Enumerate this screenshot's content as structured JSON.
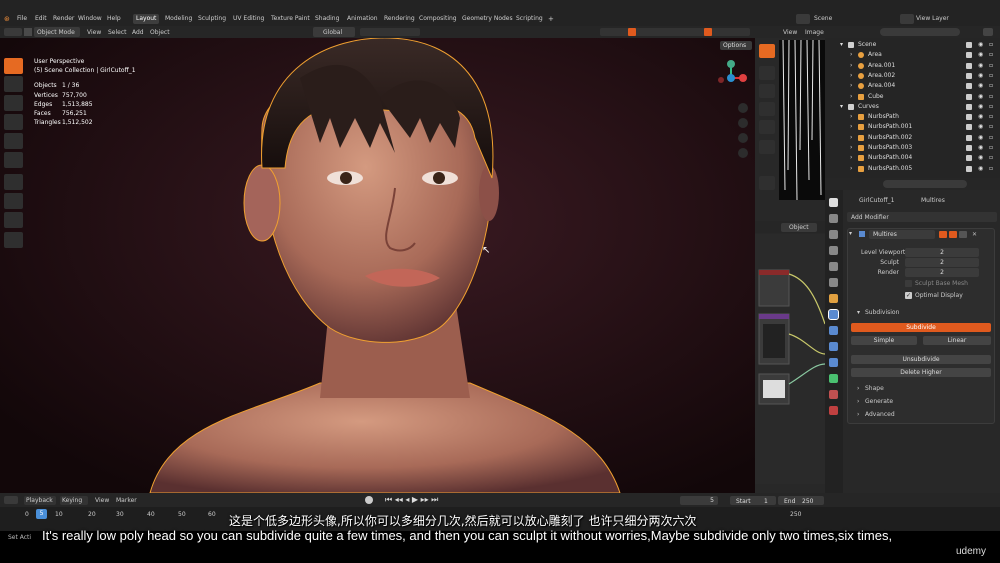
{
  "menu": [
    "File",
    "Edit",
    "Render",
    "Window",
    "Help"
  ],
  "workspaces": [
    "Layout",
    "Modeling",
    "Sculpting",
    "UV Editing",
    "Texture Paint",
    "Shading",
    "Animation",
    "Rendering",
    "Compositing",
    "Geometry Nodes",
    "Scripting"
  ],
  "scene_label": "Scene",
  "view_layer_label": "View Layer",
  "header": {
    "mode": "Object Mode",
    "view": "View",
    "select": "Select",
    "add": "Add",
    "object": "Object",
    "orientation": "Global",
    "options": "Options"
  },
  "overlay": {
    "perspective": "User Perspective",
    "collection": "(5) Scene Collection | GirlCutoff_1"
  },
  "stats": {
    "objects_label": "Objects",
    "objects": "1 / 36",
    "vertices_label": "Vertices",
    "vertices": "757,700",
    "edges_label": "Edges",
    "edges": "1,513,885",
    "faces_label": "Faces",
    "faces": "756,251",
    "triangles_label": "Triangles",
    "triangles": "1,512,502"
  },
  "right_header": {
    "view": "View",
    "image": "Image",
    "object": "Object"
  },
  "outliner": [
    {
      "name": "Scene",
      "indent": 0,
      "icon": "folder"
    },
    {
      "name": "Area",
      "indent": 1,
      "icon": "light"
    },
    {
      "name": "Area.001",
      "indent": 1,
      "icon": "light"
    },
    {
      "name": "Area.002",
      "indent": 1,
      "icon": "light"
    },
    {
      "name": "Area.004",
      "indent": 1,
      "icon": "light"
    },
    {
      "name": "Cube",
      "indent": 1,
      "icon": "mesh"
    },
    {
      "name": "Curves",
      "indent": 0,
      "icon": "folder"
    },
    {
      "name": "NurbsPath",
      "indent": 1,
      "icon": "curve"
    },
    {
      "name": "NurbsPath.001",
      "indent": 1,
      "icon": "curve"
    },
    {
      "name": "NurbsPath.002",
      "indent": 1,
      "icon": "curve"
    },
    {
      "name": "NurbsPath.003",
      "indent": 1,
      "icon": "curve"
    },
    {
      "name": "NurbsPath.004",
      "indent": 1,
      "icon": "curve"
    },
    {
      "name": "NurbsPath.005",
      "indent": 1,
      "icon": "curve"
    }
  ],
  "properties": {
    "object_name": "GirlCutoff_1",
    "modifier_tab": "Multires",
    "add_modifier": "Add Modifier",
    "modifier_name": "Multires",
    "level_viewport_label": "Level Viewport",
    "level_viewport": "2",
    "sculpt_label": "Sculpt",
    "sculpt": "2",
    "render_label": "Render",
    "render": "2",
    "sculpt_base_mesh": "Sculpt Base Mesh",
    "optimal_display": "Optimal Display",
    "subdivision_label": "Subdivision",
    "subdivide": "Subdivide",
    "simple": "Simple",
    "linear": "Linear",
    "unsubdivide": "Unsubdivide",
    "delete_higher": "Delete Higher",
    "shape": "Shape",
    "generate": "Generate",
    "advanced": "Advanced"
  },
  "timeline": {
    "playback": "Playback",
    "keying": "Keying",
    "view": "View",
    "marker": "Marker",
    "current": "5",
    "start_label": "Start",
    "start": "1",
    "end_label": "End",
    "end": "250",
    "ticks": [
      "0",
      "10",
      "20",
      "30",
      "40",
      "50",
      "60",
      "250"
    ],
    "frame_marker": "5",
    "status": "Set Acti"
  },
  "subtitles": {
    "chinese": "这是个低多边形头像,所以你可以多细分几次,然后就可以放心雕刻了 也许只细分两次六次",
    "english": "It's really low poly head so you can subdivide quite a few times, and then you can sculpt it without worries,Maybe subdivide only two times,six times,"
  },
  "watermark": "udemy",
  "colors": {
    "accent": "#e66a22",
    "outline": "#f0a030"
  }
}
